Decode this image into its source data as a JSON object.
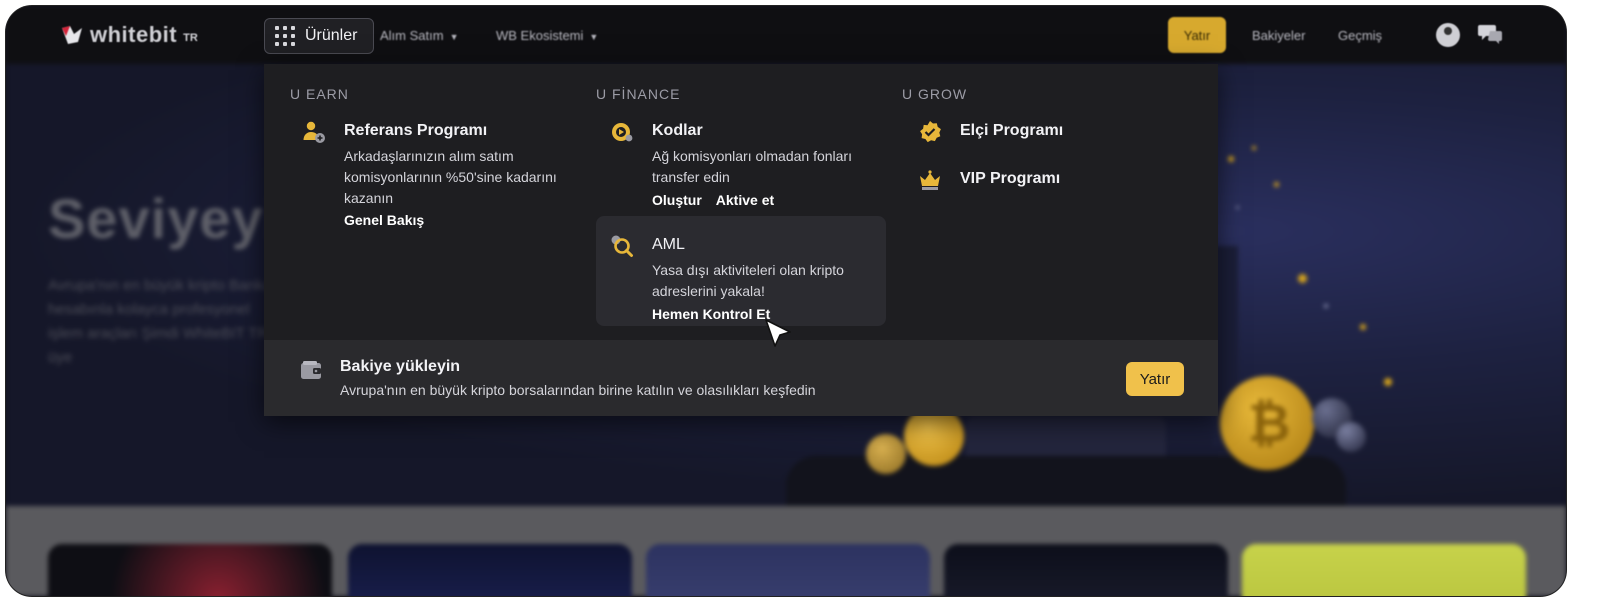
{
  "brand": {
    "logo_text": "whitebit",
    "logo_suffix": "TR"
  },
  "nav": {
    "products_label": "Ürünler",
    "links": [
      {
        "label": "Alım Satım"
      },
      {
        "label": "WB Ekosistemi"
      }
    ],
    "deposit_label": "Yatır",
    "balances_label": "Bakiyeler",
    "history_label": "Geçmiş"
  },
  "background": {
    "hero_title": "Seviyeyi",
    "hero_paragraph": "Avrupa'nın en büyük kripto Banka hesabınla kolayca profesyonel işlem araçları Şimdi WhiteBIT TR'ye üye"
  },
  "menu": {
    "columns": [
      {
        "heading": "U EARN",
        "items": [
          {
            "title": "Referans Programı",
            "description": "Arkadaşlarınızın alım satım komisyonlarının %50'sine kadarını kazanın",
            "links": [
              "Genel Bakış"
            ],
            "icon": "user-plus-icon"
          }
        ]
      },
      {
        "heading": "U FİNANCE",
        "items": [
          {
            "title": "Kodlar",
            "description": "Ağ komisyonları olmadan fonları transfer edin",
            "links": [
              "Oluştur",
              "Aktive et"
            ],
            "icon": "code-coin-icon"
          },
          {
            "title": "AML",
            "description": "Yasa dışı aktiviteleri olan kripto adreslerini yakala!",
            "links": [
              "Hemen Kontrol Et"
            ],
            "icon": "search-coin-icon",
            "highlighted": true
          }
        ]
      },
      {
        "heading": "U GROW",
        "items": [
          {
            "title": "Elçi Programı",
            "icon": "badge-check-icon"
          },
          {
            "title": "VIP Programı",
            "icon": "crown-icon"
          }
        ]
      }
    ],
    "footer": {
      "title": "Bakiye yükleyin",
      "subtitle": "Avrupa'nın en büyük kripto borsalarından birine katılın ve olasılıkları keşfedin",
      "button_label": "Yatır",
      "icon": "wallet-icon"
    }
  },
  "colors": {
    "accent": "#f0c14b",
    "menu_bg": "#1e1e21",
    "highlight_bg": "#2b2b30",
    "icon_gold": "#e7b73a"
  }
}
